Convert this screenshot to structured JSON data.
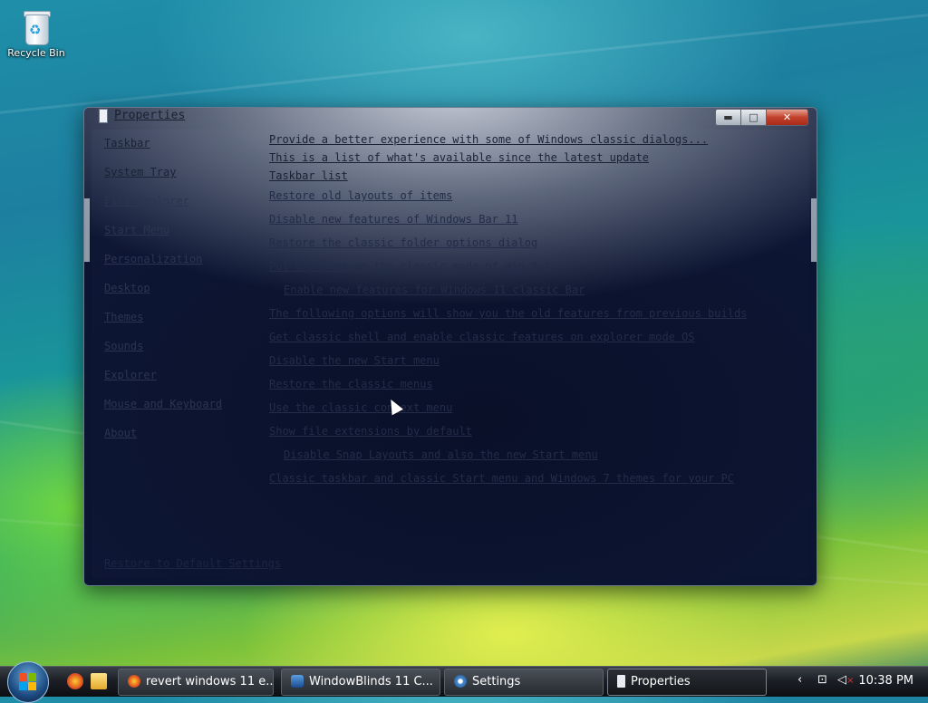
{
  "desktop": {
    "recycle_bin_label": "Recycle Bin"
  },
  "window": {
    "title": "Properties",
    "buttons": {
      "minimize": "▬",
      "maximize": "□",
      "close": "✕"
    },
    "nav": [
      "Taskbar",
      "System Tray",
      "File Explorer",
      "Start Menu",
      "Personalization",
      "Desktop",
      "Themes",
      "Sounds",
      "Explorer",
      "Mouse and Keyboard",
      "About"
    ],
    "bottom_link": "Restore to Default Settings",
    "content_lines": [
      "Provide a better experience with some of Windows classic dialogs...",
      "This is a list of what's available since the latest update",
      "Taskbar list",
      "Restore old layouts of items",
      "Disable new features of Windows Bar 11",
      "Restore the classic folder options dialog",
      "Put explorer on the classic mode of Win 8.1",
      "Enable new features for Windows 11 classic Bar",
      "The following options will show you the old features from previous builds",
      "Get classic shell and enable classic features on explorer mode OS",
      "Disable the new Start menu",
      "Restore the classic menus",
      "Use the classic context menu",
      "Show file extensions by default",
      "Disable Snap Layouts and also the new Start menu",
      "Classic taskbar and classic Start menu and Windows 7 themes for your PC"
    ]
  },
  "taskbar": {
    "tasks": [
      {
        "label": "revert windows 11 e...",
        "icon": "firefox-icon"
      },
      {
        "label": "WindowBlinds 11 C...",
        "icon": "windowblinds-icon"
      },
      {
        "label": "Settings",
        "icon": "settings-icon"
      },
      {
        "label": "Properties",
        "icon": "properties-icon"
      }
    ],
    "clock": "10:38 PM"
  },
  "colors": {
    "window_bg": "#0b1430",
    "close_red": "#c0412c",
    "text_dim": "#232c48"
  }
}
